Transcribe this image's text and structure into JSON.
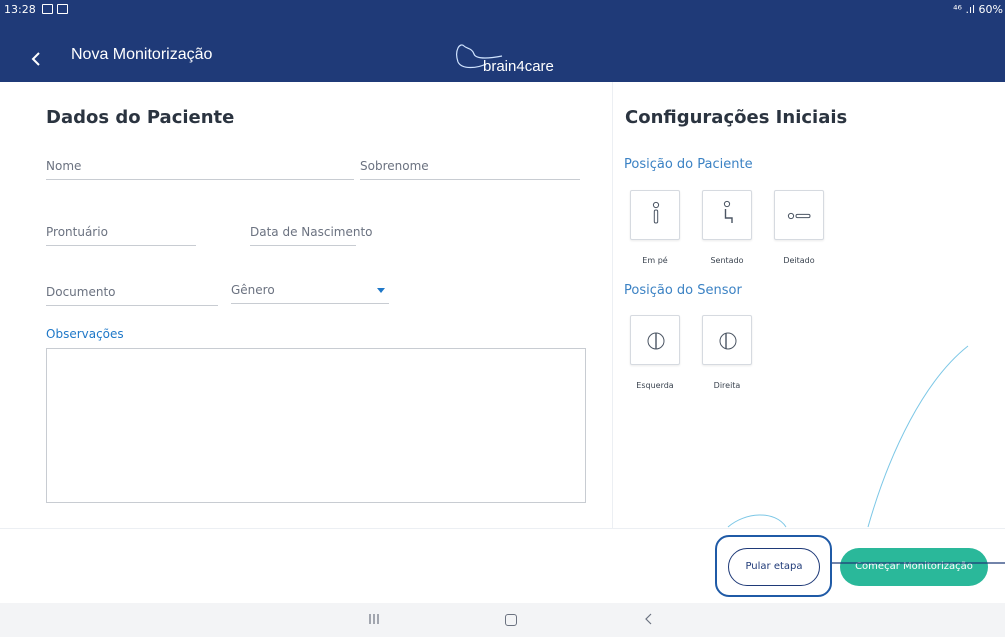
{
  "statusbar": {
    "time": "13:28",
    "right_text": "⁴⁶ .ıl 60%"
  },
  "appbar": {
    "title": "Nova Monitorização",
    "logo_text": "brain4care"
  },
  "patient": {
    "section_title": "Dados do Paciente",
    "fields": {
      "nome": "Nome",
      "sobrenome": "Sobrenome",
      "prontuario": "Prontuário",
      "data_nascimento": "Data de Nascimento",
      "documento": "Documento",
      "genero": "Gênero"
    },
    "observacoes_label": "Observações",
    "observacoes_value": ""
  },
  "config": {
    "section_title": "Configurações Iniciais",
    "patient_position": {
      "title": "Posição do Paciente",
      "options": [
        "Em pé",
        "Sentado",
        "Deitado"
      ]
    },
    "sensor_position": {
      "title": "Posição do Sensor",
      "options": [
        "Esquerda",
        "Direita"
      ]
    }
  },
  "footer": {
    "skip_label": "Pular etapa",
    "start_label": "Começar Monitorização"
  },
  "colors": {
    "header": "#1f3a78",
    "accent": "#2ab89a",
    "link": "#1f78c8"
  }
}
